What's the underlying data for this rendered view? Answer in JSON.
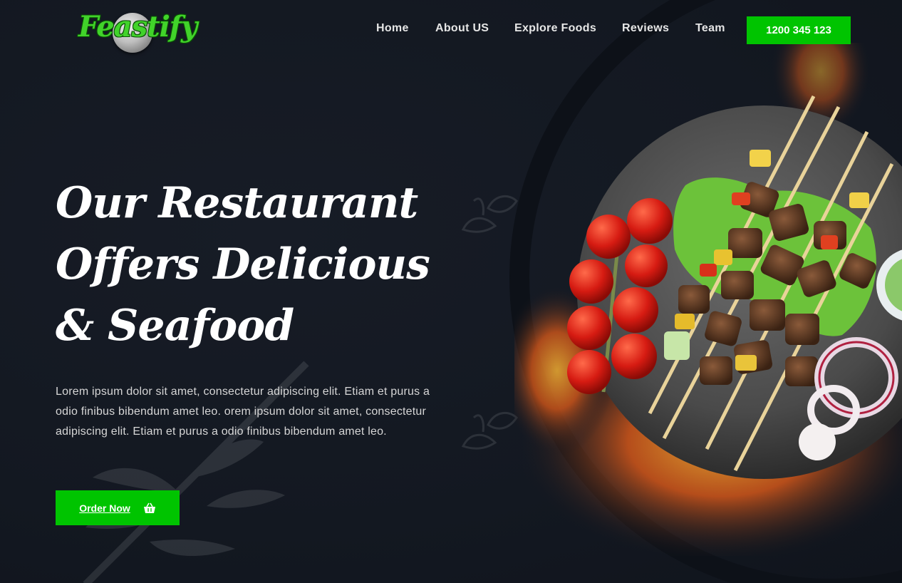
{
  "brand": {
    "logo_text": "Feastify",
    "accent_color": "#00c400"
  },
  "nav": {
    "items": [
      {
        "label": "Home"
      },
      {
        "label": "About US"
      },
      {
        "label": "Explore Foods"
      },
      {
        "label": "Reviews"
      },
      {
        "label": "Team"
      }
    ],
    "phone_label": "1200 345 123"
  },
  "hero": {
    "title": "Our Restaurant Offers Delicious & Seafood",
    "description": "Lorem ipsum dolor sit amet, consectetur adipiscing elit. Etiam et purus a odio finibus bibendum amet leo. orem ipsum dolor sit amet, consectetur adipiscing elit. Etiam et purus a odio finibus bibendum amet leo.",
    "order_button": "Order Now",
    "order_icon": "basket-icon"
  },
  "colors": {
    "background": "#131821",
    "text": "#ffffff",
    "muted_text": "#d6d6d6"
  }
}
